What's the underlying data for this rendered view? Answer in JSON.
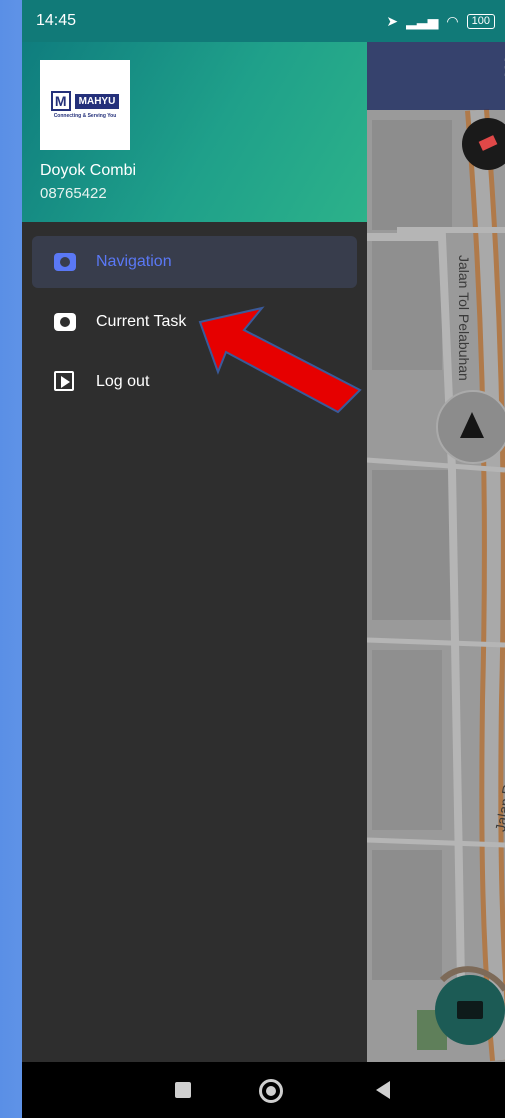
{
  "status_bar": {
    "time": "14:45",
    "battery": "100"
  },
  "drawer": {
    "logo": {
      "brand": "MAHYU",
      "tagline": "Connecting & Serving You"
    },
    "user_name": "Doyok Combi",
    "user_phone": "08765422",
    "menu": [
      {
        "label": "Navigation",
        "icon": "camera-icon",
        "active": true
      },
      {
        "label": "Current Task",
        "icon": "camera-icon",
        "active": false
      },
      {
        "label": "Log out",
        "icon": "video-library-icon",
        "active": false
      }
    ]
  },
  "map": {
    "road_labels": [
      "Jalan Tol Pelabuhan",
      "Jalan R. E. M"
    ]
  },
  "colors": {
    "status_bar": "#117a78",
    "drawer_bg": "#2e2e2e",
    "active_item": "#5a78f5",
    "annotation_arrow": "#e60000"
  }
}
